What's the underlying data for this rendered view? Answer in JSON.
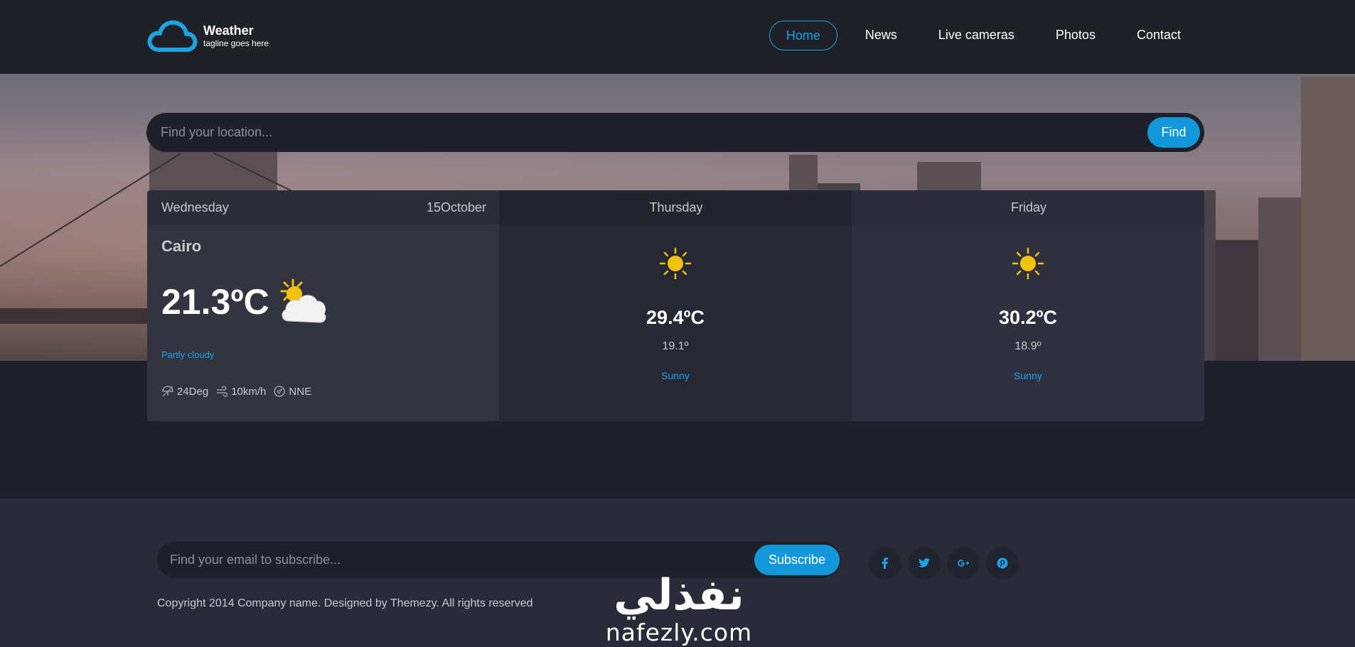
{
  "brand": {
    "title": "Weather",
    "tagline": "tagline goes here"
  },
  "nav": [
    {
      "label": "Home",
      "active": true
    },
    {
      "label": "News"
    },
    {
      "label": "Live cameras"
    },
    {
      "label": "Photos"
    },
    {
      "label": "Contact"
    }
  ],
  "search": {
    "placeholder": "Find your location...",
    "button": "Find"
  },
  "today": {
    "day": "Wednesday",
    "date": "15October",
    "city": "Cairo",
    "temp": "21.3ºC",
    "condition": "Partly cloudy",
    "humidity": "24Deg",
    "wind_speed": "10km/h",
    "wind_dir": "NNE",
    "icon": "partly-cloudy-icon"
  },
  "forecast": [
    {
      "day": "Thursday",
      "high": "29.4ºC",
      "low": "19.1º",
      "condition": "Sunny",
      "icon": "sun-icon"
    },
    {
      "day": "Friday",
      "high": "30.2ºC",
      "low": "18.9º",
      "condition": "Sunny",
      "icon": "sun-icon"
    }
  ],
  "subscribe": {
    "placeholder": "Find your email to subscribe...",
    "button": "Subscribe"
  },
  "socials": [
    "facebook-icon",
    "twitter-icon",
    "google-plus-icon",
    "pinterest-icon"
  ],
  "copyright": "Copyright 2014 Company name. Designed by Themezy. All rights reserved",
  "watermark": {
    "arabic": "نفذلي",
    "latin": "nafezly.com"
  },
  "colors": {
    "accent": "#1ca3e6",
    "button": "#1297d9",
    "header_bg": "#1e2226",
    "card_bg": "#323440"
  }
}
